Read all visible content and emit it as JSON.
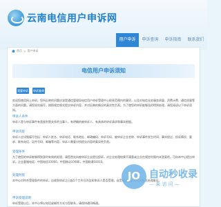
{
  "site": {
    "title": "云南电信用户申诉网"
  },
  "nav": {
    "items": [
      "用户申诉",
      "申诉查询",
      "申诉指南",
      "联系我们"
    ]
  },
  "breadcrumb": {
    "home": "首页",
    "separator": ">",
    "current": "用户申诉"
  },
  "page": {
    "banner": "电信用户申诉须知",
    "complain_button": "我要申诉",
    "query_button": "申诉查询"
  },
  "content": {
    "intro": "欢迎您使用网上申诉。您所反映的问题应该是通信管理局电信用户申诉受理中心职责范围内的事项，以及对电信业务服务质量、资费计费、通信质量等方面的问题。请您如实填写，按照规定格式提交申诉内容，并对反映的情况的真实性负责。为了使您的申诉能够及时得到处理，请您阅读以下申诉须知。",
    "s1_title": "申诉人条件",
    "s1_text": "申诉人是与申诉事件有直接利害关系的当事人，有明确的被申诉人、有具体的申诉请求和事实根据。",
    "s2_title": "申诉内容",
    "s2_text": "申诉人应详细填写包括：申诉人姓名、申诉电话、联系地址、邮政编码、申诉号码、被申诉企业名称、申诉事件发生时间、事实经过、投诉情况、要求、联系电话、证件号码、邮箱等内容，申诉人需要对所提交内容的真实性负责。",
    "s3_title": "受理条件",
    "s3_text": "为了使您的申诉能够得到及时有效的处理，请您首先向被申诉企业提出投诉，对企业处理结果不满意或企业在规定时限内未答复的，可向本中心提出申诉。企业客服电话：中国电信10000，中国移动10086，中国联通10010。",
    "s4_title": "处理时限",
    "s4_text": "本中心对符合受理条件的申诉，自收到申诉之日起5个工作日内告知申诉人是否受理，自受理之日起30日内作出处理意见。",
    "s5_title": "申诉受理说明",
    "s5_text": "申诉受理以后，本中心将以电话或邮件方式与您联系，请保持通讯畅通。"
  },
  "watermark": {
    "badge": "JO",
    "title": "自动秒收录",
    "subtitle": "—  未 访 问  —"
  }
}
